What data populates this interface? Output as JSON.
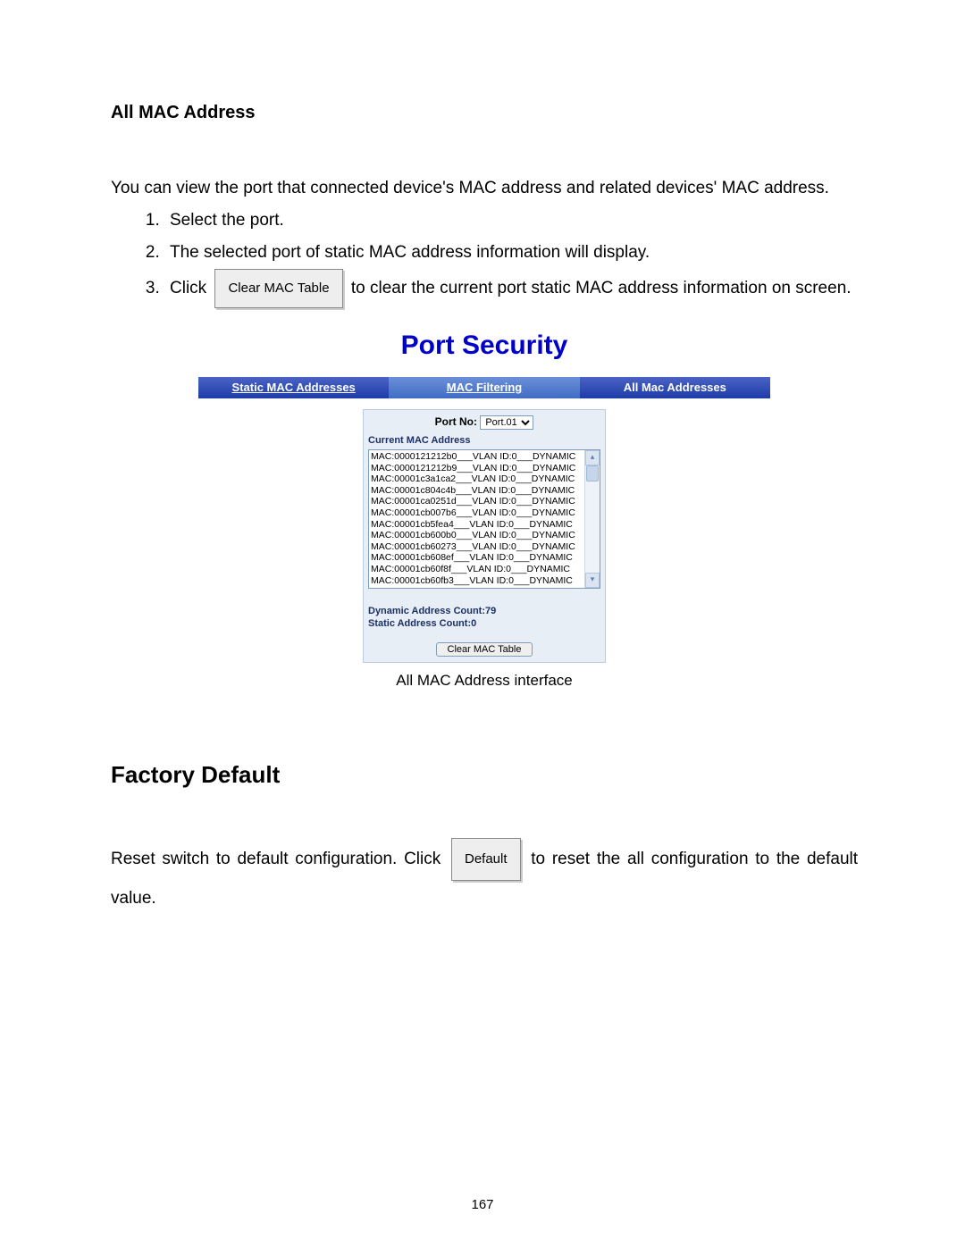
{
  "headings": {
    "all_mac": "All MAC Address",
    "factory_default": "Factory Default"
  },
  "intro": "You can view the port that connected device's MAC address and related devices' MAC address.",
  "steps": {
    "s1": "Select the port.",
    "s2": "The selected port of static MAC address information will display.",
    "s3a": "Click",
    "s3_btn": "Clear MAC Table",
    "s3b": "to clear the current port static MAC address information on screen."
  },
  "screenshot": {
    "title": "Port Security",
    "tabs": {
      "static": "Static MAC Addresses",
      "filter": "MAC Filtering",
      "all": "All Mac Addresses"
    },
    "port_no_label": "Port No:",
    "port_no_value": "Port.01",
    "current_label": "Current MAC Address",
    "mac_rows": [
      "MAC:0000121212b0___VLAN ID:0___DYNAMIC",
      "MAC:0000121212b9___VLAN ID:0___DYNAMIC",
      "MAC:00001c3a1ca2___VLAN ID:0___DYNAMIC",
      "MAC:00001c804c4b___VLAN ID:0___DYNAMIC",
      "MAC:00001ca0251d___VLAN ID:0___DYNAMIC",
      "MAC:00001cb007b6___VLAN ID:0___DYNAMIC",
      "MAC:00001cb5fea4___VLAN ID:0___DYNAMIC",
      "MAC:00001cb600b0___VLAN ID:0___DYNAMIC",
      "MAC:00001cb60273___VLAN ID:0___DYNAMIC",
      "MAC:00001cb608ef___VLAN ID:0___DYNAMIC",
      "MAC:00001cb60f8f___VLAN ID:0___DYNAMIC",
      "MAC:00001cb60fb3___VLAN ID:0___DYNAMIC"
    ],
    "dynamic_count": "Dynamic Address Count:79",
    "static_count": "Static Address Count:0",
    "clear_btn": "Clear MAC Table",
    "caption": "All MAC Address interface"
  },
  "factory": {
    "line_a": "Reset switch to default configuration. Click",
    "btn": "Default",
    "line_b": "to reset the all configuration to the default value."
  },
  "page_number": "167"
}
